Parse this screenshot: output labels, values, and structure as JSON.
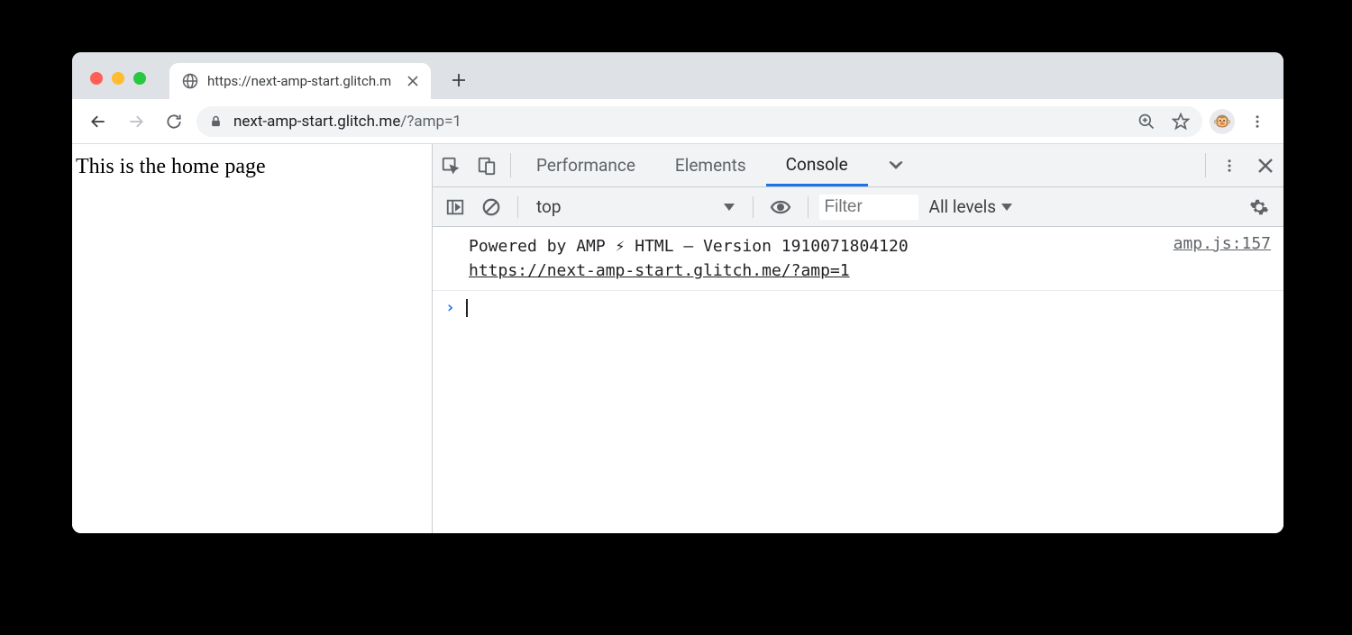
{
  "browser": {
    "tab_title": "https://next-amp-start.glitch.m",
    "url_domain": "next-amp-start.glitch.me",
    "url_path": "/?amp=1"
  },
  "page": {
    "body_text": "This is the home page"
  },
  "devtools": {
    "tabs": {
      "performance": "Performance",
      "elements": "Elements",
      "console": "Console"
    },
    "toolbar": {
      "context": "top",
      "filter_placeholder": "Filter",
      "levels": "All levels"
    },
    "log": {
      "message_line1": "Powered by AMP ⚡ HTML – Version 1910071804120",
      "message_url": "https://next-amp-start.glitch.me/?amp=1",
      "source": "amp.js:157"
    }
  }
}
